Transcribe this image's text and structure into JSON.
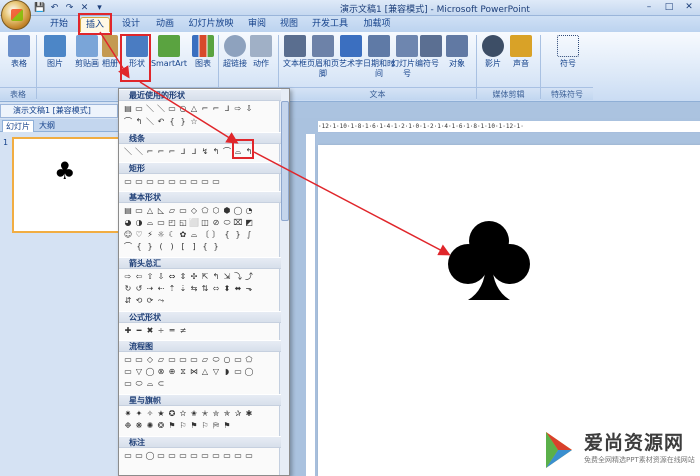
{
  "titlebar": {
    "title": "演示文稿1 [兼容模式] - Microsoft PowerPoint",
    "qat": [
      "💾",
      "↶",
      "↷",
      "✕",
      "▾"
    ],
    "controls": [
      "–",
      "□",
      "✕"
    ]
  },
  "tabs": [
    "开始",
    "插入",
    "设计",
    "动画",
    "幻灯片放映",
    "审阅",
    "视图",
    "开发工具",
    "加载项"
  ],
  "ribbon": {
    "items": [
      {
        "label": "表格",
        "color": "#6a8fca"
      },
      {
        "label": "图片",
        "color": "#4c86c7"
      },
      {
        "label": "剪贴画",
        "color": "#7aa5d8"
      },
      {
        "label": "相册",
        "color": "#c49a52"
      },
      {
        "label": "形状",
        "color": "#4a7cc2"
      },
      {
        "label": "SmartArt",
        "color": "#5aa340"
      },
      {
        "label": "图表",
        "color": "#d84a2a"
      },
      {
        "label": "超链接",
        "color": "#8ea2be"
      },
      {
        "label": "动作",
        "color": "#a0b0c6"
      },
      {
        "label": "文本框",
        "color": "#5a6e8f"
      },
      {
        "label": "页眉和页脚",
        "color": "#6d82a8"
      },
      {
        "label": "艺术字",
        "color": "#3b6fc0"
      },
      {
        "label": "日期和时间",
        "color": "#5f7aa6"
      },
      {
        "label": "幻灯片编号",
        "color": "#6e86af"
      },
      {
        "label": "符号",
        "color": "#5b6f92"
      },
      {
        "label": "对象",
        "color": "#6179a3"
      },
      {
        "label": "影片",
        "color": "#3d4e66"
      },
      {
        "label": "声音",
        "color": "#d9a227"
      },
      {
        "label": "符号",
        "color": "#2f4a78"
      }
    ],
    "groups": [
      "表格",
      "插图",
      "链接",
      "文本",
      "媒体剪辑",
      "特殊符号"
    ]
  },
  "doc_tab": "演示文稿1 [兼容模式]",
  "pane_tabs": [
    "幻灯片",
    "大纲"
  ],
  "slide_number": "1",
  "club": "♣",
  "ruler_text": "·12·1·10·1·8·1·6·1·4·1·2·1·0·1·2·1·4·1·6·1·8·1·10·1·12·1·",
  "dropdown": {
    "sections": [
      {
        "title": "最近使用的形状",
        "rows": [
          [
            "▤",
            "▭",
            "＼",
            "＼",
            "▭",
            "○",
            "△",
            "⌐",
            "⌐",
            "ᒧ",
            "⇨",
            "⇩"
          ],
          [
            "⌒",
            "↰",
            "＼",
            "↶",
            "{",
            "}",
            "☆"
          ]
        ]
      },
      {
        "title": "线条",
        "rows": [
          [
            "＼",
            "＼",
            "⌐",
            "⌐",
            "⌐",
            "ᒧ",
            "ᒧ",
            "↯",
            "↰",
            "⌒",
            "⌓",
            "↰"
          ]
        ]
      },
      {
        "title": "矩形",
        "rows": [
          [
            "▭",
            "▭",
            "▭",
            "▭",
            "▭",
            "▭",
            "▭",
            "▭",
            "▭"
          ]
        ]
      },
      {
        "title": "基本形状",
        "rows": [
          [
            "▤",
            "▭",
            "△",
            "◺",
            "▱",
            "▭",
            "◇",
            "⬠",
            "⬡",
            "⬢",
            "◯",
            "◔"
          ],
          [
            "◕",
            "◑",
            "⌓",
            "▭",
            "◰",
            "◱",
            "⬜",
            "◫",
            "⊘",
            "⬭",
            "⌧",
            "◩"
          ],
          [
            "☺",
            "♡",
            "⚡",
            "☼",
            "☾",
            "✿",
            "⌓",
            "〔",
            "〕",
            "{",
            "}",
            "∫"
          ],
          [
            "⌒",
            "{",
            "}",
            "(",
            ")",
            "[",
            "]",
            "{",
            "}"
          ]
        ]
      },
      {
        "title": "箭头总汇",
        "rows": [
          [
            "⇨",
            "⇦",
            "⇧",
            "⇩",
            "⇔",
            "⇕",
            "✣",
            "⇱",
            "↰",
            "⇲",
            "⤵",
            "⤴"
          ],
          [
            "↻",
            "↺",
            "⇢",
            "⇠",
            "⇡",
            "⇣",
            "⇆",
            "⇅",
            "⬄",
            "⬍",
            "⬌",
            "⬎"
          ],
          [
            "⇵",
            "⟲",
            "⟳",
            "⤳"
          ]
        ]
      },
      {
        "title": "公式形状",
        "rows": [
          [
            "✚",
            "━",
            "✖",
            "÷",
            "═",
            "≠"
          ]
        ]
      },
      {
        "title": "流程图",
        "rows": [
          [
            "▭",
            "▭",
            "◇",
            "▱",
            "▭",
            "▭",
            "▭",
            "▱",
            "⬭",
            "○",
            "▭",
            "⬠"
          ],
          [
            "▭",
            "▽",
            "◯",
            "⊗",
            "⊕",
            "⧖",
            "⋈",
            "△",
            "▽",
            "◗",
            "▭",
            "◯"
          ],
          [
            "▭",
            "⬭",
            "⌓",
            "⊂"
          ]
        ]
      },
      {
        "title": "星与旗帜",
        "rows": [
          [
            "✷",
            "✦",
            "✧",
            "★",
            "✪",
            "✫",
            "✬",
            "✭",
            "✮",
            "✯",
            "✰",
            "✱"
          ],
          [
            "❉",
            "❋",
            "✺",
            "❂",
            "⚑",
            "⚐",
            "⚑",
            "⚐",
            "⛿",
            "⚑"
          ]
        ]
      },
      {
        "title": "标注",
        "rows": [
          [
            "▭",
            "▭",
            "◯",
            "▭",
            "▭",
            "▭",
            "▭",
            "▭",
            "▭",
            "▭",
            "▭",
            "▭"
          ]
        ]
      }
    ]
  },
  "watermark": {
    "title": "爱尚资源网",
    "subtitle": "免费全网精选PPT素材资源在线网站"
  }
}
